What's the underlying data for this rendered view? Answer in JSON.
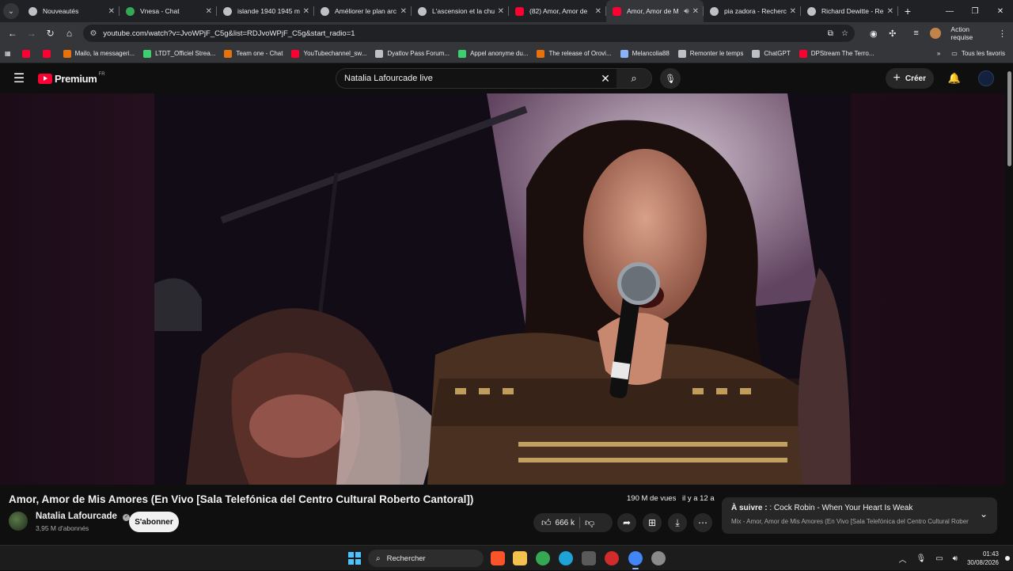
{
  "browser": {
    "tabs": [
      {
        "title": "Nouveautés",
        "icon": "gray"
      },
      {
        "title": "Vnesa - Chat",
        "icon": "green"
      },
      {
        "title": "islande 1940 1945 m",
        "icon": "gray"
      },
      {
        "title": "Améliorer le plan arc",
        "icon": "gray"
      },
      {
        "title": "L'ascension et la chut",
        "icon": "gray"
      },
      {
        "title": "(82) Amor, Amor de",
        "icon": "yt"
      },
      {
        "title": "Amor, Amor de M",
        "icon": "yt",
        "active": true
      },
      {
        "title": "pia zadora - Recherc",
        "icon": "gray"
      },
      {
        "title": "Richard Dewitte - Re",
        "icon": "gray"
      }
    ],
    "url": "youtube.com/watch?v=JvoWPjF_C5g&list=RDJvoWPjF_C5g&start_radio=1",
    "action_required": "Action requise",
    "bookmarks": [
      {
        "label": "",
        "icon": "yt"
      },
      {
        "label": "",
        "icon": "yt"
      },
      {
        "label": "Mailo, la messageri...",
        "icon": "org"
      },
      {
        "label": "LTDT_Officiel Strea...",
        "icon": "grn"
      },
      {
        "label": "Team one - Chat",
        "icon": "org"
      },
      {
        "label": "YouTubechannel_sw...",
        "icon": "yt"
      },
      {
        "label": "Dyatlov Pass Forum...",
        "icon": "gray"
      },
      {
        "label": "Appel anonyme du...",
        "icon": "grn"
      },
      {
        "label": "The release of Orovi...",
        "icon": "org"
      },
      {
        "label": "Melancolia88",
        "icon": "blu"
      },
      {
        "label": "Remonter le temps",
        "icon": "gray"
      },
      {
        "label": "ChatGPT",
        "icon": "gray"
      },
      {
        "label": "DPStream The Terro...",
        "icon": "yt"
      }
    ],
    "all_bookmarks": "Tous les favoris"
  },
  "youtube": {
    "logo_text": "Premium",
    "country_code": "FR",
    "search_query": "Natalia Lafourcade live",
    "create_label": "Créer"
  },
  "video": {
    "title": "Amor, Amor de Mis Amores (En Vivo [Sala Telefónica del Centro Cultural Roberto Cantoral])",
    "views": "190 M de vues",
    "age": "il y a 12 a",
    "channel": "Natalia Lafourcade",
    "subscribers": "3,95 M d'abonnés",
    "subscribe_label": "S'abonner",
    "likes": "666 k"
  },
  "up_next": {
    "prefix": "À suivre :",
    "title": ": Cock Robin - When Your Heart Is Weak",
    "playlist": "Mix - Amor, Amor de Mis Amores (En Vivo [Sala Telefónica del Centro Cultural Rober"
  },
  "taskbar": {
    "search_label": "Rechercher",
    "time": "01:43",
    "date": "30/08/2026"
  },
  "colors": {
    "youtube_red": "#ff0033",
    "background": "#0f0f0f",
    "windows_blue": "#4cc2ff"
  }
}
